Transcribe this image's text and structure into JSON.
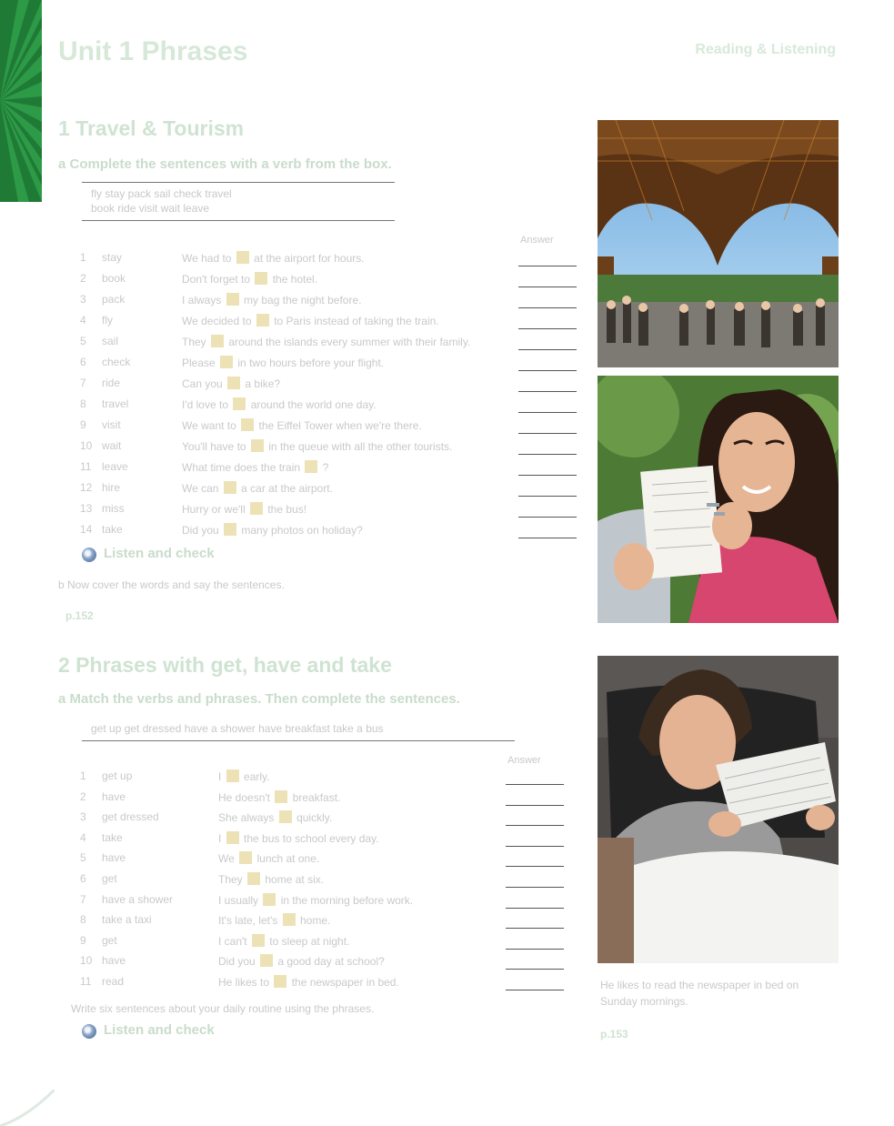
{
  "header": {
    "unit_title": "Unit 1 Phrases",
    "running_head": "Reading & Listening"
  },
  "section1": {
    "title": "1 Travel & Tourism",
    "task": "a Complete the sentences with a verb from the box.",
    "box_line1": "fly  stay  pack  sail  check  travel",
    "box_line2": "book  ride  visit  wait  leave",
    "column_head": "Answer",
    "rows": [
      {
        "num": "1",
        "word": "stay",
        "before": "We had to",
        "after": "at the airport for hours."
      },
      {
        "num": "2",
        "word": "book",
        "before": "Don't forget to",
        "after": "the hotel."
      },
      {
        "num": "3",
        "word": "pack",
        "before": "I always",
        "after": "my bag the night before."
      },
      {
        "num": "4",
        "word": "fly",
        "before": "We decided to",
        "after": "to Paris instead of taking the train."
      },
      {
        "num": "5",
        "word": "sail",
        "before": "They",
        "after": "around the islands every summer with their family."
      },
      {
        "num": "6",
        "word": "check",
        "before": "Please",
        "after": "in two hours before your flight."
      },
      {
        "num": "7",
        "word": "ride",
        "before": "Can you",
        "after": "a bike?"
      },
      {
        "num": "8",
        "word": "travel",
        "before": "I'd love to",
        "after": "around the world one day."
      },
      {
        "num": "9",
        "word": "visit",
        "before": "We want to",
        "after": "the Eiffel Tower when we're there."
      },
      {
        "num": "10",
        "word": "wait",
        "before": "You'll have to",
        "after": "in the queue with all the other tourists."
      },
      {
        "num": "11",
        "word": "leave",
        "before": "What time does the train",
        "after": "?"
      },
      {
        "num": "12",
        "word": "hire",
        "before": "We can",
        "after": "a car at the airport."
      },
      {
        "num": "13",
        "word": "miss",
        "before": "Hurry or we'll",
        "after": "the bus!"
      },
      {
        "num": "14",
        "word": "take",
        "before": "Did you",
        "after": "many photos on holiday?"
      }
    ],
    "listen_label": "Listen and check",
    "instruction": "b Now cover the words and say the sentences.",
    "sub_label": "p.152"
  },
  "section2": {
    "title": "2 Phrases with get, have and take",
    "task": "a Match the verbs and phrases. Then complete the sentences.",
    "box_text": "get up  get dressed  have a shower  have breakfast  take a bus",
    "column_head": "Answer",
    "rows": [
      {
        "num": "1",
        "word": "get up",
        "before": "I",
        "after": "early."
      },
      {
        "num": "2",
        "word": "have",
        "before": "He doesn't",
        "after": "breakfast."
      },
      {
        "num": "3",
        "word": "get dressed",
        "before": "She always",
        "after": "quickly."
      },
      {
        "num": "4",
        "word": "take",
        "before": "I",
        "after": "the bus to school every day."
      },
      {
        "num": "5",
        "word": "have",
        "before": "We",
        "after": "lunch at one."
      },
      {
        "num": "6",
        "word": "get",
        "before": "They",
        "after": "home at six."
      },
      {
        "num": "7",
        "word": "have a shower",
        "before": "I usually",
        "after": "in the morning before work."
      },
      {
        "num": "8",
        "word": "take a taxi",
        "before": "It's late, let's",
        "after": "home."
      },
      {
        "num": "9",
        "word": "get",
        "before": "I can't",
        "after": "to sleep at night."
      },
      {
        "num": "10",
        "word": "have",
        "before": "Did you",
        "after": "a good day at school?"
      },
      {
        "num": "11",
        "word": "read",
        "before": "He likes to",
        "after": "the newspaper in bed."
      }
    ],
    "footer_instruction": "Write six sentences about your daily routine using the phrases.",
    "listen_label": "Listen and check"
  },
  "photos": {
    "eiffel_caption": "",
    "girl_caption": "",
    "man_caption": "He likes to read the newspaper in bed on Sunday mornings.",
    "man_sub": "p.153"
  },
  "colors": {
    "brand_green": "#1f7a35",
    "gap_fill": "#ece2b6",
    "faded_text": "#c9c9c9"
  },
  "icons": [
    "cd-icon"
  ]
}
